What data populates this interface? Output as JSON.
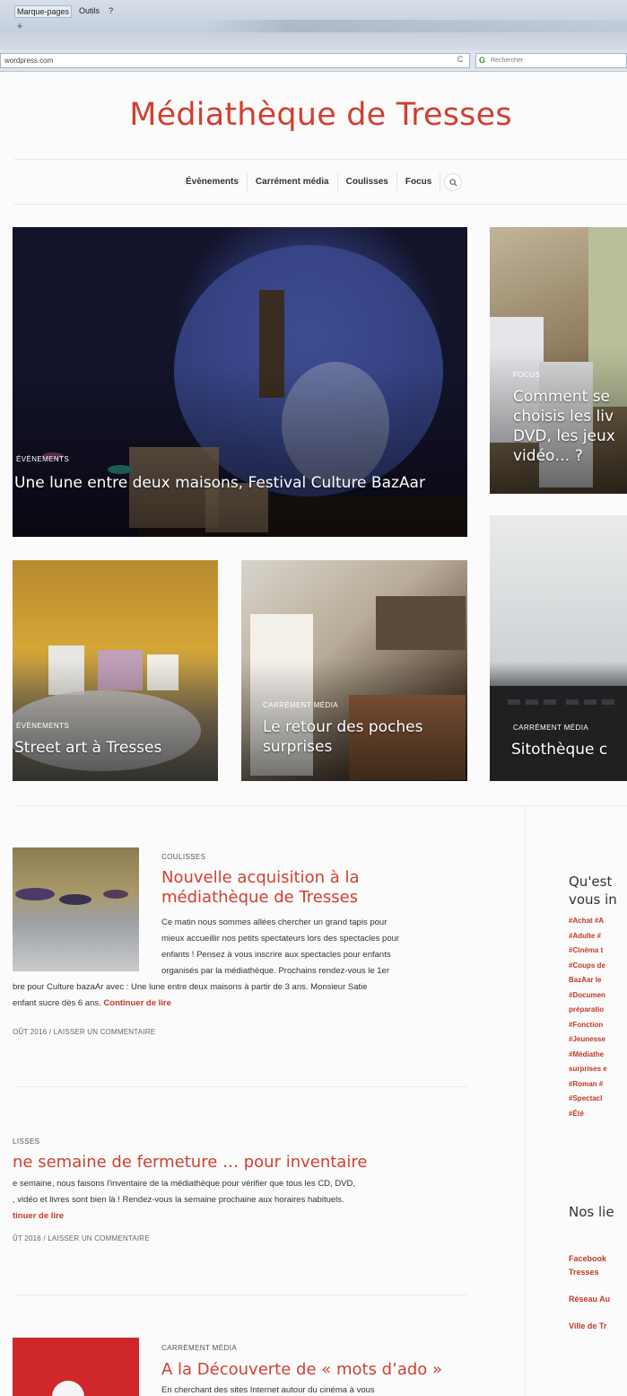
{
  "browser": {
    "menu": [
      "Marque-pages",
      "Outils",
      "?"
    ],
    "new_tab": "+",
    "url": "wordpress.com",
    "reload": "C",
    "search_placeholder": "Rechercher"
  },
  "site": {
    "title": "Médiathèque de Tresses",
    "nav": [
      "Évènements",
      "Carrément média",
      "Coulisses",
      "Focus"
    ]
  },
  "featured": [
    {
      "category": "Évènements",
      "title": "Une lune entre deux maisons, Festival Culture BazAar"
    },
    {
      "category": "Focus",
      "title": "Comment se choisis les liv DVD, les jeux vidéo… ?"
    },
    {
      "category": "Évènements",
      "title": "Street art à Tresses"
    },
    {
      "category": "Carrément média",
      "title": "Le retour des poches surprises"
    },
    {
      "category": "Carrément média",
      "title": "Sitothèque c"
    }
  ],
  "posts": [
    {
      "category": "Coulisses",
      "title": "Nouvelle acquisition à la médiathèque de Tresses",
      "excerpt_lines": [
        "Ce matin nous sommes allées chercher un grand tapis pour",
        "mieux accueillir nos petits spectateurs lors des spectacles pour",
        "enfants ! Pensez à vous inscrire aux spectacles pour enfants",
        "organisés par la médiathèque. Prochains rendez-vous  le 1er",
        "bre pour Culture bazaAr avec : Une lune entre deux maisons à partir de 3 ans. Monsieur Satie",
        "enfant sucre dès 6  ans."
      ],
      "more": "Continuer de lire",
      "meta": "oût 2016 / Laisser un commentaire"
    },
    {
      "category": "lisses",
      "title": "ne semaine de fermeture … pour inventaire",
      "excerpt_lines": [
        "e semaine, nous faisons l'inventaire de la médiathèque pour vérifier  que tous les CD, DVD,",
        ", vidéo et livres sont bien là ! Rendez-vous la semaine prochaine aux horaires habituels."
      ],
      "more": "tinuer de lire",
      "meta": "ût 2016 / Laisser un commentaire"
    },
    {
      "category": "Carrément média",
      "title": "A la Découverte de « mots d’ado »",
      "excerpt_lines": [
        "En cherchant des sites Internet autour du cinéma à vous"
      ]
    }
  ],
  "sidebar": {
    "tags_title": "Qu'est vous in",
    "tags": [
      "#Achat #A",
      "#Adulte #",
      "#Cinéma t",
      "#Coups de",
      "BazAar le",
      "#Documen",
      "préparatio",
      "#Fonction",
      "#Jeunesse",
      "#Médiathe",
      "surprises e",
      "#Roman #",
      "#Spectacl",
      "#Été"
    ],
    "links_title": "Nos lie",
    "links": [
      "Facebook",
      "Tresses",
      "Réseau Au",
      "Ville de Tr"
    ]
  }
}
